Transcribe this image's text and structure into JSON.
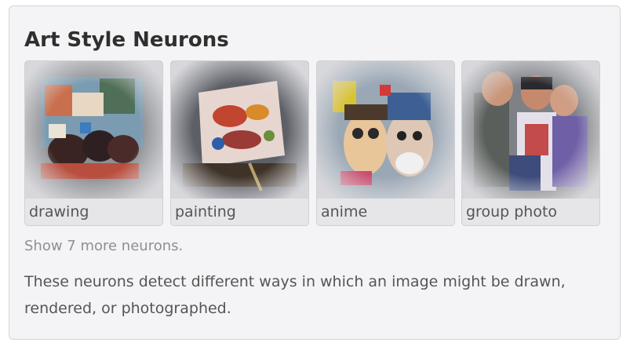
{
  "panel": {
    "title": "Art Style Neurons",
    "neurons": [
      {
        "label": "drawing",
        "image": "drawing-feature-visualization"
      },
      {
        "label": "painting",
        "image": "painting-feature-visualization"
      },
      {
        "label": "anime",
        "image": "anime-feature-visualization"
      },
      {
        "label": "group photo",
        "image": "group-photo-feature-visualization"
      }
    ],
    "show_more": "Show 7 more neurons.",
    "description": "These neurons detect different ways in which an image might be drawn, rendered, or photographed."
  }
}
